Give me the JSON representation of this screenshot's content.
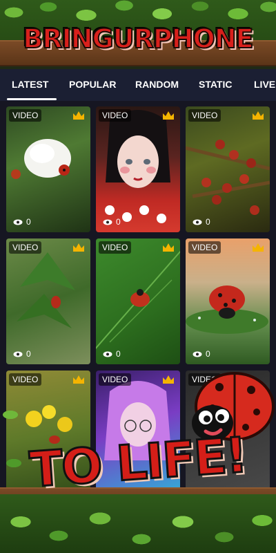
{
  "banner": {
    "title": "BRINGURPHONE"
  },
  "tabs": [
    {
      "label": "LATEST"
    },
    {
      "label": "POPULAR"
    },
    {
      "label": "RANDOM"
    },
    {
      "label": "STATIC"
    },
    {
      "label": "LIVE"
    }
  ],
  "active_tab": "LATEST",
  "tiles": [
    {
      "badge": "VIDEO",
      "views": "0",
      "premium": true,
      "scene": "white flower with ladybugs",
      "icon": "crown-icon"
    },
    {
      "badge": "VIDEO",
      "views": "0",
      "premium": true,
      "scene": "girl in red polka dot outfit",
      "icon": "crown-icon"
    },
    {
      "badge": "VIDEO",
      "views": "0",
      "premium": true,
      "scene": "cluster of ladybugs on branch",
      "icon": "crown-icon"
    },
    {
      "badge": "VIDEO",
      "views": "0",
      "premium": true,
      "scene": "ladybug on nettle leaves",
      "icon": "crown-icon"
    },
    {
      "badge": "VIDEO",
      "views": "0",
      "premium": true,
      "scene": "ladybug on green leaf",
      "icon": "crown-icon"
    },
    {
      "badge": "VIDEO",
      "views": "0",
      "premium": true,
      "scene": "ladybug with dew drops",
      "icon": "crown-icon"
    },
    {
      "badge": "VIDEO",
      "views": "",
      "premium": true,
      "scene": "yellow flowers with ladybug",
      "icon": "crown-icon"
    },
    {
      "badge": "VIDEO",
      "views": "",
      "premium": true,
      "scene": "anime girl with neon hair",
      "icon": "crown-icon"
    },
    {
      "badge": "VIDEO",
      "views": "",
      "premium": false,
      "scene": "partially hidden tile",
      "icon": ""
    }
  ],
  "promo": {
    "caption": "TO LIFE!"
  },
  "colors": {
    "tabbar_bg": "#1b1f33",
    "title_red": "#d8201c",
    "crown_gold": "#f5b400"
  }
}
